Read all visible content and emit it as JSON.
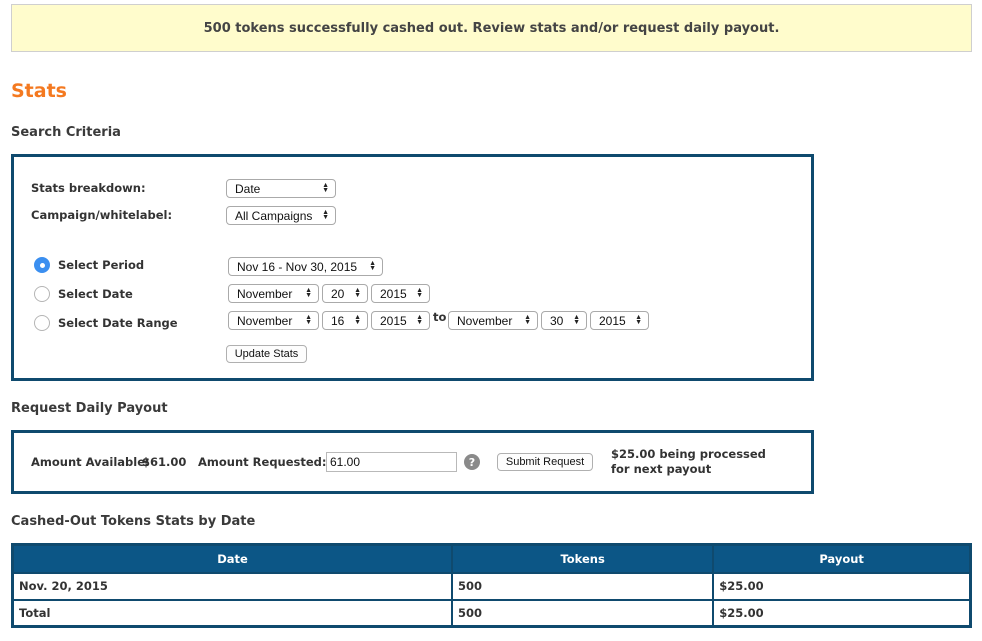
{
  "notice": "500 tokens successfully cashed out. Review stats and/or request daily payout.",
  "page_title": "Stats",
  "search": {
    "title": "Search Criteria",
    "breakdown_label": "Stats breakdown:",
    "breakdown_value": "Date",
    "campaign_label": "Campaign/whitelabel:",
    "campaign_value": "All Campaigns",
    "period_label": "Select Period",
    "period_value": "Nov 16 - Nov 30, 2015",
    "period_checked": true,
    "date_label": "Select Date",
    "date_month": "November",
    "date_day": "20",
    "date_year": "2015",
    "range_label": "Select Date Range",
    "range_from_month": "November",
    "range_from_day": "16",
    "range_from_year": "2015",
    "range_to_text": "to",
    "range_to_month": "November",
    "range_to_day": "30",
    "range_to_year": "2015",
    "update_button": "Update Stats"
  },
  "payout": {
    "title": "Request Daily Payout",
    "available_label": "Amount Available:",
    "available_value": "$61.00",
    "requested_label": "Amount Requested: $",
    "requested_value": "61.00",
    "help_icon": "?",
    "submit_button": "Submit Request",
    "processing_text": "$25.00 being processed for next payout"
  },
  "table": {
    "title": "Cashed-Out Tokens Stats by Date",
    "headers": [
      "Date",
      "Tokens",
      "Payout"
    ],
    "rows": [
      [
        "Nov. 20, 2015",
        "500",
        "$25.00"
      ],
      [
        "Total",
        "500",
        "$25.00"
      ]
    ]
  },
  "colors": {
    "accent_orange": "#f47920",
    "border_navy": "#0f4a6e",
    "header_blue": "#0c5686",
    "notice_bg": "#fffccc",
    "radio_blue": "#3b8ff0"
  }
}
